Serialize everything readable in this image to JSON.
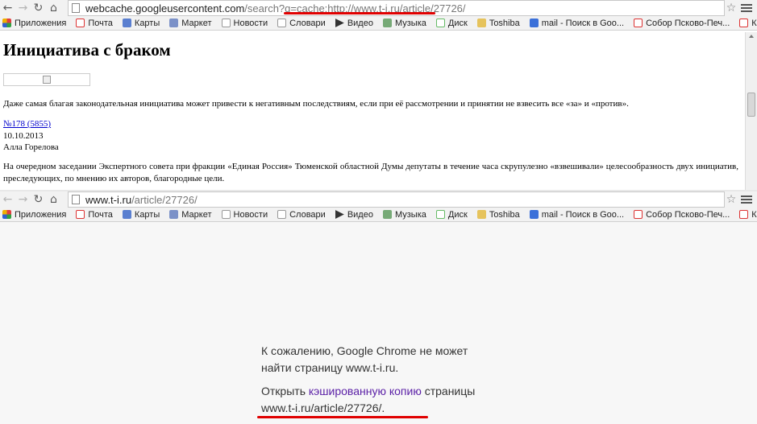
{
  "window1": {
    "url_host": "webcache.googleusercontent.com",
    "url_path": "/search?q=cache:http://www.t-i.ru/article/27726/"
  },
  "window2": {
    "url_host": "www.t-i.ru",
    "url_path": "/article/27726/"
  },
  "nav_icons": [
    "back-arrow-icon",
    "forward-arrow-icon",
    "reload-icon",
    "home-icon"
  ],
  "bookmarks": [
    {
      "label": "Приложения",
      "icon": "apps"
    },
    {
      "label": "Почта",
      "icon": "ya"
    },
    {
      "label": "Карты",
      "icon": "bp"
    },
    {
      "label": "Маркет",
      "icon": "mk"
    },
    {
      "label": "Новости",
      "icon": "doc"
    },
    {
      "label": "Словари",
      "icon": "doc"
    },
    {
      "label": "Видео",
      "icon": "vid"
    },
    {
      "label": "Музыка",
      "icon": "mus"
    },
    {
      "label": "Диск",
      "icon": "disk"
    },
    {
      "label": "Toshiba",
      "icon": "folder"
    },
    {
      "label": "mail - Поиск в Goo...",
      "icon": "g"
    },
    {
      "label": "Собор Псково-Печ...",
      "icon": "ya"
    },
    {
      "label": "Константин Яросла...",
      "icon": "ya"
    }
  ],
  "article": {
    "title": "Инициатива с браком",
    "lede": "Даже самая благая законодательная инициатива может привести к негативным последствиям, если при её рассмотрении и принятии не взвесить все «за» и «против».",
    "issue_link": "№178 (5855)",
    "date": "10.10.2013",
    "author": "Алла Горелова",
    "body": "На очередном заседании Экспертного совета при фракции «Единая Россия» Тюменской областной Думы депутаты в течение часа скрупулезно «взвешивали» целесообразность двух инициатив, преследующих, по мнению их авторов, благородные цели."
  },
  "error_page": {
    "line1": "К сожалению, Google Chrome не может найти страницу www.t-i.ru.",
    "line2_prefix": "Открыть ",
    "line2_link": "кэшированную копию",
    "line2_suffix": " страницы www.t-i.ru/article/27726/."
  },
  "colors": {
    "annotation_red": "#e00000",
    "link_blue": "#0000cc",
    "visited_purple": "#5a1fa6"
  }
}
